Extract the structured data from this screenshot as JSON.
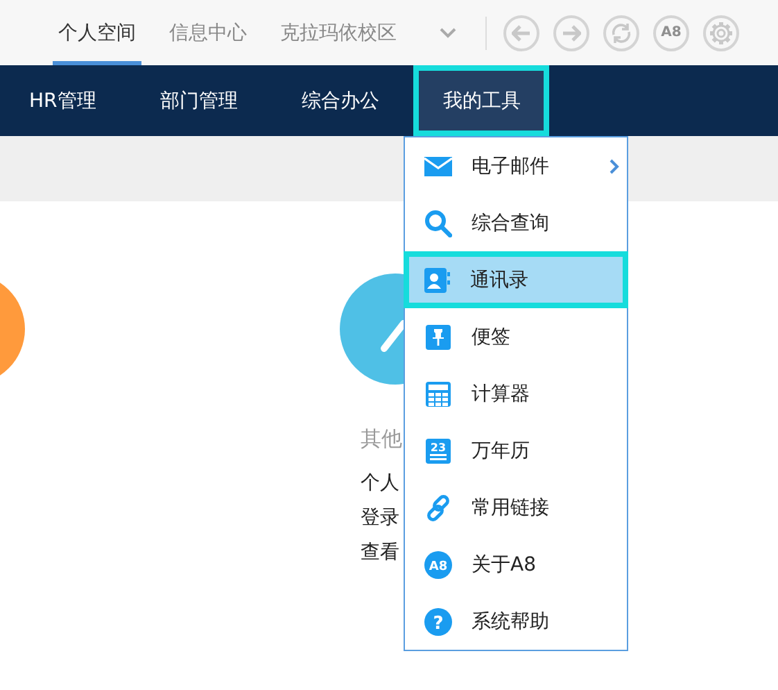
{
  "top_tabs": [
    {
      "label": "个人空间",
      "selected": true
    },
    {
      "label": "信息中心",
      "selected": false
    },
    {
      "label": "克拉玛依校区",
      "selected": false
    }
  ],
  "toolbar": [
    {
      "kind": "back"
    },
    {
      "kind": "forward"
    },
    {
      "kind": "refresh"
    },
    {
      "kind": "badge",
      "label": "A8"
    },
    {
      "kind": "settings"
    }
  ],
  "nav": [
    {
      "label": "HR管理",
      "selected": false
    },
    {
      "label": "部门管理",
      "selected": false
    },
    {
      "label": "综合办公",
      "selected": false
    },
    {
      "label": "我的工具",
      "selected": true
    }
  ],
  "content": {
    "title": "其他",
    "lines": [
      "个人",
      "登录",
      "查看"
    ]
  },
  "menu": [
    {
      "kind": "mail",
      "label": "电子邮件",
      "submenu": true,
      "selected": false
    },
    {
      "kind": "search",
      "label": "综合查询",
      "submenu": false,
      "selected": false
    },
    {
      "kind": "contacts",
      "label": "通讯录",
      "submenu": false,
      "selected": true
    },
    {
      "kind": "pin",
      "label": "便签",
      "submenu": false,
      "selected": false
    },
    {
      "kind": "calculator",
      "label": "计算器",
      "submenu": false,
      "selected": false
    },
    {
      "kind": "calendar",
      "label": "万年历",
      "submenu": false,
      "selected": false,
      "badge": "23"
    },
    {
      "kind": "link",
      "label": "常用链接",
      "submenu": false,
      "selected": false
    },
    {
      "kind": "about",
      "label": "关于A8",
      "submenu": false,
      "selected": false,
      "badge": "A8"
    },
    {
      "kind": "help",
      "label": "系统帮助",
      "submenu": false,
      "selected": false,
      "badge": "?"
    }
  ]
}
